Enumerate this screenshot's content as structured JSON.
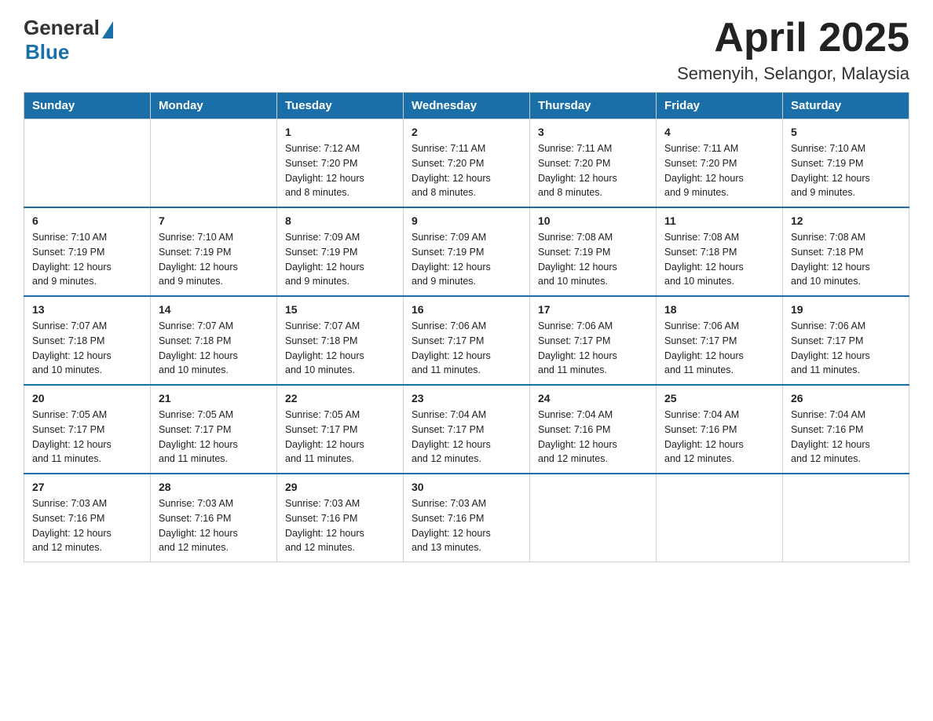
{
  "header": {
    "logo_general": "General",
    "logo_blue": "Blue",
    "month_title": "April 2025",
    "location": "Semenyih, Selangor, Malaysia"
  },
  "days_of_week": [
    "Sunday",
    "Monday",
    "Tuesday",
    "Wednesday",
    "Thursday",
    "Friday",
    "Saturday"
  ],
  "weeks": [
    [
      {
        "day": "",
        "info": ""
      },
      {
        "day": "",
        "info": ""
      },
      {
        "day": "1",
        "info": "Sunrise: 7:12 AM\nSunset: 7:20 PM\nDaylight: 12 hours\nand 8 minutes."
      },
      {
        "day": "2",
        "info": "Sunrise: 7:11 AM\nSunset: 7:20 PM\nDaylight: 12 hours\nand 8 minutes."
      },
      {
        "day": "3",
        "info": "Sunrise: 7:11 AM\nSunset: 7:20 PM\nDaylight: 12 hours\nand 8 minutes."
      },
      {
        "day": "4",
        "info": "Sunrise: 7:11 AM\nSunset: 7:20 PM\nDaylight: 12 hours\nand 9 minutes."
      },
      {
        "day": "5",
        "info": "Sunrise: 7:10 AM\nSunset: 7:19 PM\nDaylight: 12 hours\nand 9 minutes."
      }
    ],
    [
      {
        "day": "6",
        "info": "Sunrise: 7:10 AM\nSunset: 7:19 PM\nDaylight: 12 hours\nand 9 minutes."
      },
      {
        "day": "7",
        "info": "Sunrise: 7:10 AM\nSunset: 7:19 PM\nDaylight: 12 hours\nand 9 minutes."
      },
      {
        "day": "8",
        "info": "Sunrise: 7:09 AM\nSunset: 7:19 PM\nDaylight: 12 hours\nand 9 minutes."
      },
      {
        "day": "9",
        "info": "Sunrise: 7:09 AM\nSunset: 7:19 PM\nDaylight: 12 hours\nand 9 minutes."
      },
      {
        "day": "10",
        "info": "Sunrise: 7:08 AM\nSunset: 7:19 PM\nDaylight: 12 hours\nand 10 minutes."
      },
      {
        "day": "11",
        "info": "Sunrise: 7:08 AM\nSunset: 7:18 PM\nDaylight: 12 hours\nand 10 minutes."
      },
      {
        "day": "12",
        "info": "Sunrise: 7:08 AM\nSunset: 7:18 PM\nDaylight: 12 hours\nand 10 minutes."
      }
    ],
    [
      {
        "day": "13",
        "info": "Sunrise: 7:07 AM\nSunset: 7:18 PM\nDaylight: 12 hours\nand 10 minutes."
      },
      {
        "day": "14",
        "info": "Sunrise: 7:07 AM\nSunset: 7:18 PM\nDaylight: 12 hours\nand 10 minutes."
      },
      {
        "day": "15",
        "info": "Sunrise: 7:07 AM\nSunset: 7:18 PM\nDaylight: 12 hours\nand 10 minutes."
      },
      {
        "day": "16",
        "info": "Sunrise: 7:06 AM\nSunset: 7:17 PM\nDaylight: 12 hours\nand 11 minutes."
      },
      {
        "day": "17",
        "info": "Sunrise: 7:06 AM\nSunset: 7:17 PM\nDaylight: 12 hours\nand 11 minutes."
      },
      {
        "day": "18",
        "info": "Sunrise: 7:06 AM\nSunset: 7:17 PM\nDaylight: 12 hours\nand 11 minutes."
      },
      {
        "day": "19",
        "info": "Sunrise: 7:06 AM\nSunset: 7:17 PM\nDaylight: 12 hours\nand 11 minutes."
      }
    ],
    [
      {
        "day": "20",
        "info": "Sunrise: 7:05 AM\nSunset: 7:17 PM\nDaylight: 12 hours\nand 11 minutes."
      },
      {
        "day": "21",
        "info": "Sunrise: 7:05 AM\nSunset: 7:17 PM\nDaylight: 12 hours\nand 11 minutes."
      },
      {
        "day": "22",
        "info": "Sunrise: 7:05 AM\nSunset: 7:17 PM\nDaylight: 12 hours\nand 11 minutes."
      },
      {
        "day": "23",
        "info": "Sunrise: 7:04 AM\nSunset: 7:17 PM\nDaylight: 12 hours\nand 12 minutes."
      },
      {
        "day": "24",
        "info": "Sunrise: 7:04 AM\nSunset: 7:16 PM\nDaylight: 12 hours\nand 12 minutes."
      },
      {
        "day": "25",
        "info": "Sunrise: 7:04 AM\nSunset: 7:16 PM\nDaylight: 12 hours\nand 12 minutes."
      },
      {
        "day": "26",
        "info": "Sunrise: 7:04 AM\nSunset: 7:16 PM\nDaylight: 12 hours\nand 12 minutes."
      }
    ],
    [
      {
        "day": "27",
        "info": "Sunrise: 7:03 AM\nSunset: 7:16 PM\nDaylight: 12 hours\nand 12 minutes."
      },
      {
        "day": "28",
        "info": "Sunrise: 7:03 AM\nSunset: 7:16 PM\nDaylight: 12 hours\nand 12 minutes."
      },
      {
        "day": "29",
        "info": "Sunrise: 7:03 AM\nSunset: 7:16 PM\nDaylight: 12 hours\nand 12 minutes."
      },
      {
        "day": "30",
        "info": "Sunrise: 7:03 AM\nSunset: 7:16 PM\nDaylight: 12 hours\nand 13 minutes."
      },
      {
        "day": "",
        "info": ""
      },
      {
        "day": "",
        "info": ""
      },
      {
        "day": "",
        "info": ""
      }
    ]
  ]
}
